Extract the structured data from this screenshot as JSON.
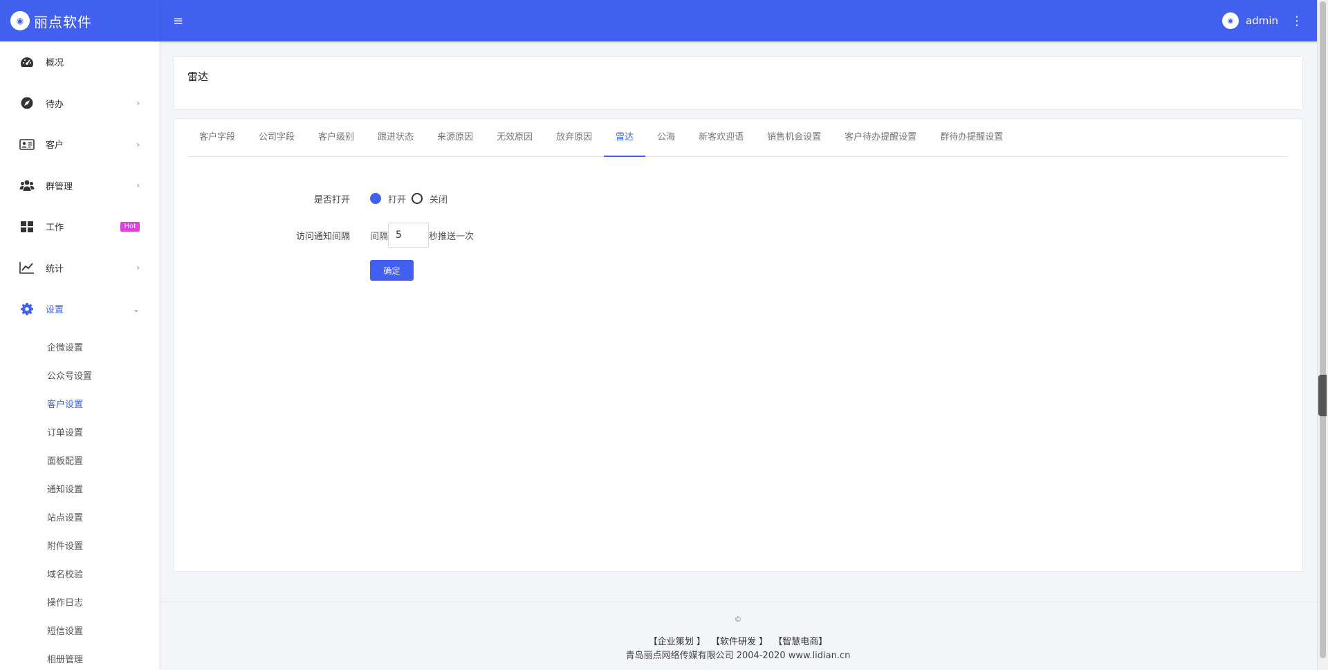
{
  "brand": {
    "name": "丽点软件",
    "logo_glyph": "◉"
  },
  "header": {
    "username": "admin",
    "menu_glyph": "≡",
    "more_glyph": "⋮"
  },
  "sidebar": {
    "items": [
      {
        "label": "概况",
        "icon": "dashboard-icon"
      },
      {
        "label": "待办",
        "icon": "compass-icon",
        "chevron": "›"
      },
      {
        "label": "客户",
        "icon": "id-card-icon",
        "chevron": "›"
      },
      {
        "label": "群管理",
        "icon": "users-icon",
        "chevron": "›"
      },
      {
        "label": "工作",
        "icon": "grid-icon",
        "badge": "Hot"
      },
      {
        "label": "统计",
        "icon": "chart-line-icon",
        "chevron": "›"
      },
      {
        "label": "设置",
        "icon": "gear-icon",
        "chevron": "⌄"
      }
    ],
    "sub_items": [
      "企微设置",
      "公众号设置",
      "客户设置",
      "订单设置",
      "面板配置",
      "通知设置",
      "站点设置",
      "附件设置",
      "域名校验",
      "操作日志",
      "短信设置",
      "相册管理"
    ]
  },
  "page": {
    "title": "雷达"
  },
  "tabs": [
    "客户字段",
    "公司字段",
    "客户级别",
    "跟进状态",
    "来源原因",
    "无效原因",
    "放弃原因",
    "雷达",
    "公海",
    "新客欢迎语",
    "销售机会设置",
    "客户待办提醒设置",
    "群待办提醒设置"
  ],
  "form": {
    "open_label": "是否打开",
    "open_option": "打开",
    "close_option": "关闭",
    "interval_label": "访问通知间隔",
    "interval_prefix": "间隔",
    "interval_value": "5",
    "interval_suffix": "秒推送一次",
    "submit_label": "确定"
  },
  "footer": {
    "copyright": "©",
    "links": [
      "【企业策划 】",
      "【软件研发 】",
      "【智慧电商】"
    ],
    "company": "青岛丽点网络传媒有限公司 2004-2020 www.lidian.cn"
  },
  "colors": {
    "primary": "#4160ef",
    "hot_badge": "#e23fd6"
  }
}
